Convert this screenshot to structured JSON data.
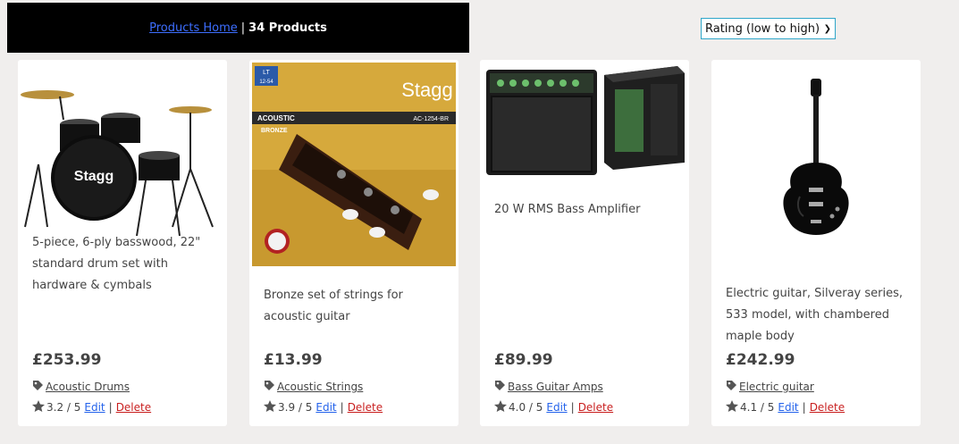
{
  "header": {
    "home_link": "Products Home",
    "separator": "|",
    "count_label": "34 Products"
  },
  "sort": {
    "selected": "Rating (low to high)"
  },
  "products": [
    {
      "description": "5-piece, 6-ply basswood, 22\" standard drum set with hardware & cymbals",
      "price": "£253.99",
      "category": "Acoustic Drums",
      "rating": "3.2 / 5",
      "edit": "Edit",
      "separator": "|",
      "delete": "Delete",
      "brand": "Stagg"
    },
    {
      "description": "Bronze set of strings for acoustic guitar",
      "price": "£13.99",
      "category": "Acoustic Strings",
      "rating": "3.9 / 5",
      "edit": "Edit",
      "separator": "|",
      "delete": "Delete",
      "brand": "Stagg",
      "pack_gauge_top": "LT",
      "pack_gauge": "12-54",
      "pack_type": "ACOUSTIC",
      "pack_code": "AC-1254-BR",
      "pack_material": "BRONZE"
    },
    {
      "description": "20 W RMS Bass Amplifier",
      "price": "£89.99",
      "category": "Bass Guitar Amps",
      "rating": "4.0 / 5",
      "edit": "Edit",
      "separator": "|",
      "delete": "Delete"
    },
    {
      "description": "Electric guitar, Silveray series, 533 model, with chambered maple body",
      "price": "£242.99",
      "category": "Electric guitar",
      "rating": "4.1 / 5",
      "edit": "Edit",
      "separator": "|",
      "delete": "Delete"
    }
  ],
  "colors": {
    "background": "#f0eeed",
    "header_bg": "#000000",
    "link_blue": "#2563eb",
    "delete_red": "#c81e1e",
    "sort_border": "#2fa6c9"
  }
}
